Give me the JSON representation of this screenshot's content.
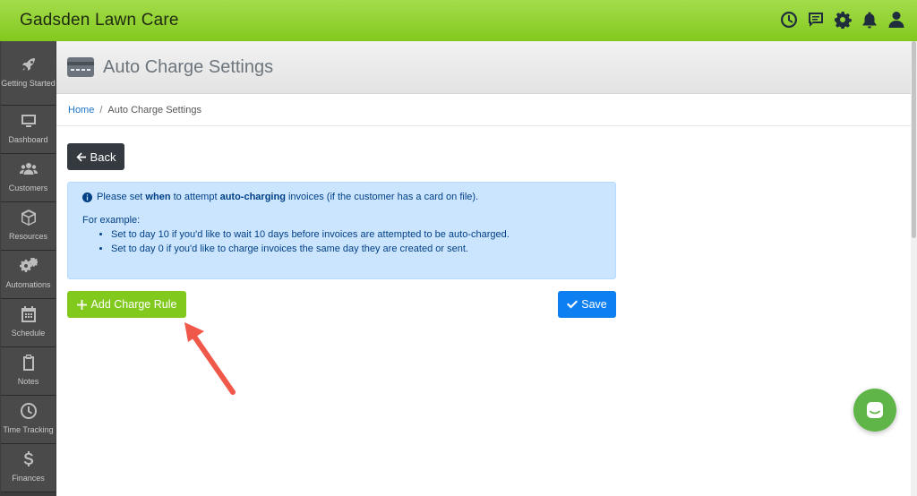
{
  "app": {
    "title": "Gadsden Lawn Care"
  },
  "topbar": {
    "icons": [
      "clock-icon",
      "chat-bubble-icon",
      "gear-icon",
      "bell-icon",
      "user-icon"
    ]
  },
  "sidebar": {
    "items": [
      {
        "label": "Getting Started",
        "icon": "rocket-icon"
      },
      {
        "label": "Dashboard",
        "icon": "monitor-icon"
      },
      {
        "label": "Customers",
        "icon": "users-icon"
      },
      {
        "label": "Resources",
        "icon": "box-icon"
      },
      {
        "label": "Automations",
        "icon": "cogs-icon"
      },
      {
        "label": "Schedule",
        "icon": "calendar-icon"
      },
      {
        "label": "Notes",
        "icon": "clipboard-icon"
      },
      {
        "label": "Time Tracking",
        "icon": "clock-icon"
      },
      {
        "label": "Finances",
        "icon": "dollar-icon"
      }
    ]
  },
  "page": {
    "title": "Auto Charge Settings",
    "breadcrumb": {
      "home": "Home",
      "separator": "/",
      "current": "Auto Charge Settings"
    }
  },
  "buttons": {
    "back": "Back",
    "add_rule": "Add Charge Rule",
    "save": "Save"
  },
  "info": {
    "line_part1": "Please set ",
    "line_bold1": "when",
    "line_part2": " to attempt ",
    "line_bold2": "auto-charging",
    "line_part3": " invoices (if the customer has a card on file).",
    "example_heading": "For example:",
    "bullets": [
      "Set to day 10 if you'd like to wait 10 days before invoices are attempted to be auto-charged.",
      "Set to day 0 if you'd like to charge invoices the same day they are created or sent."
    ]
  },
  "colors": {
    "brand_green": "#82c91e",
    "primary_blue": "#0d7ff0",
    "annotation_arrow": "#f0584a"
  }
}
